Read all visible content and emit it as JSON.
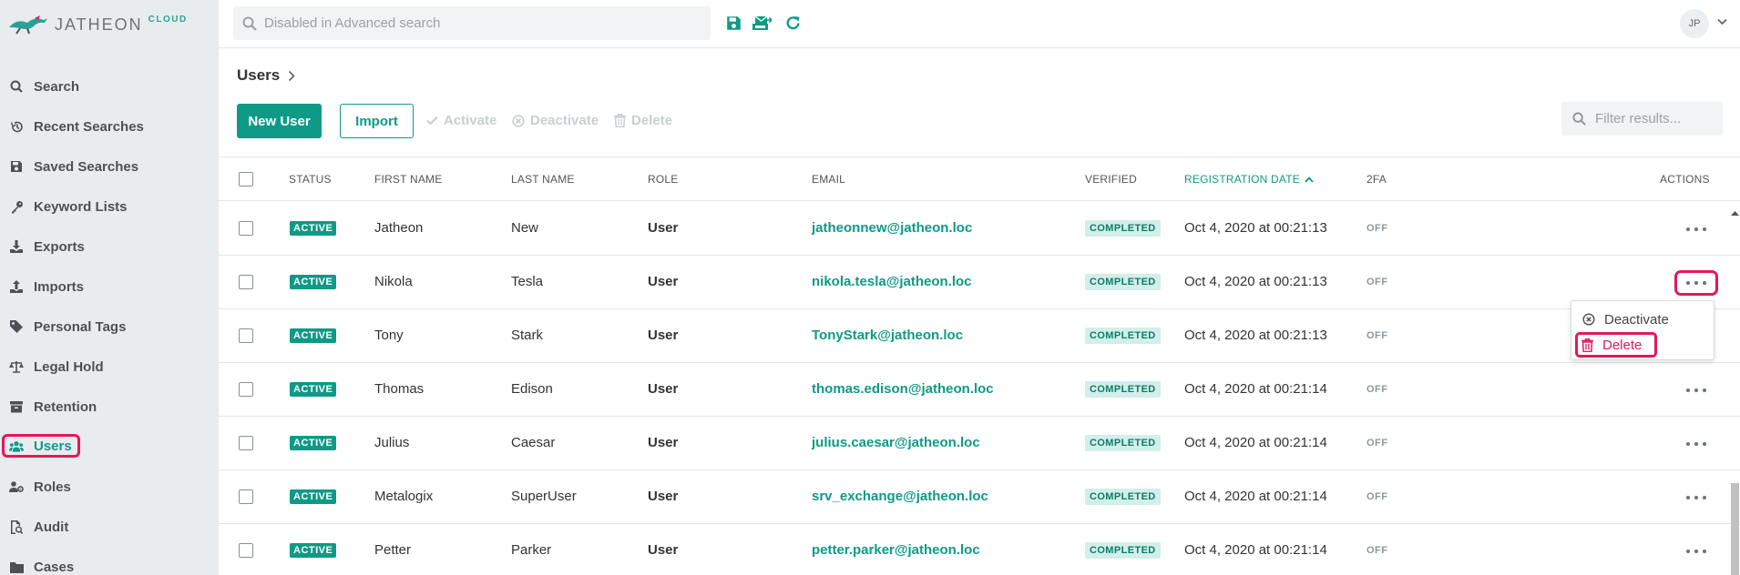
{
  "brand": {
    "name": "JATHEON",
    "suffix": "CLOUD"
  },
  "sidebar": {
    "items": [
      {
        "label": "Search",
        "icon": "search-icon"
      },
      {
        "label": "Recent Searches",
        "icon": "history-icon"
      },
      {
        "label": "Saved Searches",
        "icon": "save-icon"
      },
      {
        "label": "Keyword Lists",
        "icon": "key-icon"
      },
      {
        "label": "Exports",
        "icon": "download-icon"
      },
      {
        "label": "Imports",
        "icon": "upload-icon"
      },
      {
        "label": "Personal Tags",
        "icon": "tag-icon"
      },
      {
        "label": "Legal Hold",
        "icon": "scale-icon"
      },
      {
        "label": "Retention",
        "icon": "archive-icon"
      },
      {
        "label": "Users",
        "icon": "users-icon",
        "active": true
      },
      {
        "label": "Roles",
        "icon": "roles-icon"
      },
      {
        "label": "Audit",
        "icon": "audit-icon"
      },
      {
        "label": "Cases",
        "icon": "folder-icon"
      }
    ]
  },
  "topbar": {
    "search_placeholder": "Disabled in Advanced search",
    "avatar_initials": "JP"
  },
  "page": {
    "breadcrumb": "Users",
    "new_user_label": "New User",
    "import_label": "Import",
    "activate_label": "Activate",
    "deactivate_label": "Deactivate",
    "delete_label": "Delete",
    "filter_placeholder": "Filter results..."
  },
  "table": {
    "headers": {
      "status": "STATUS",
      "first_name": "FIRST NAME",
      "last_name": "LAST NAME",
      "role": "ROLE",
      "email": "EMAIL",
      "verified": "VERIFIED",
      "registration_date": "REGISTRATION DATE",
      "twofa": "2FA",
      "actions": "ACTIONS"
    },
    "rows": [
      {
        "status": "ACTIVE",
        "first": "Jatheon",
        "last": "New",
        "role": "User",
        "email": "jatheonnew@jatheon.loc",
        "verified": "COMPLETED",
        "date": "Oct 4, 2020 at 00:21:13",
        "twofa": "OFF"
      },
      {
        "status": "ACTIVE",
        "first": "Nikola",
        "last": "Tesla",
        "role": "User",
        "email": "nikola.tesla@jatheon.loc",
        "verified": "COMPLETED",
        "date": "Oct 4, 2020 at 00:21:13",
        "twofa": "OFF"
      },
      {
        "status": "ACTIVE",
        "first": "Tony",
        "last": "Stark",
        "role": "User",
        "email": "TonyStark@jatheon.loc",
        "verified": "COMPLETED",
        "date": "Oct 4, 2020 at 00:21:13",
        "twofa": "OFF"
      },
      {
        "status": "ACTIVE",
        "first": "Thomas",
        "last": "Edison",
        "role": "User",
        "email": "thomas.edison@jatheon.loc",
        "verified": "COMPLETED",
        "date": "Oct 4, 2020 at 00:21:14",
        "twofa": "OFF"
      },
      {
        "status": "ACTIVE",
        "first": "Julius",
        "last": "Caesar",
        "role": "User",
        "email": "julius.caesar@jatheon.loc",
        "verified": "COMPLETED",
        "date": "Oct 4, 2020 at 00:21:14",
        "twofa": "OFF"
      },
      {
        "status": "ACTIVE",
        "first": "Metalogix",
        "last": "SuperUser",
        "role": "User",
        "email": "srv_exchange@jatheon.loc",
        "verified": "COMPLETED",
        "date": "Oct 4, 2020 at 00:21:14",
        "twofa": "OFF"
      },
      {
        "status": "ACTIVE",
        "first": "Petter",
        "last": "Parker",
        "role": "User",
        "email": "petter.parker@jatheon.loc",
        "verified": "COMPLETED",
        "date": "Oct 4, 2020 at 00:21:14",
        "twofa": "OFF"
      }
    ]
  },
  "menu": {
    "deactivate": "Deactivate",
    "delete": "Delete"
  },
  "colors": {
    "accent": "#0e9a86",
    "highlight": "#e5175b",
    "sidebar_bg": "#e9ecee"
  }
}
